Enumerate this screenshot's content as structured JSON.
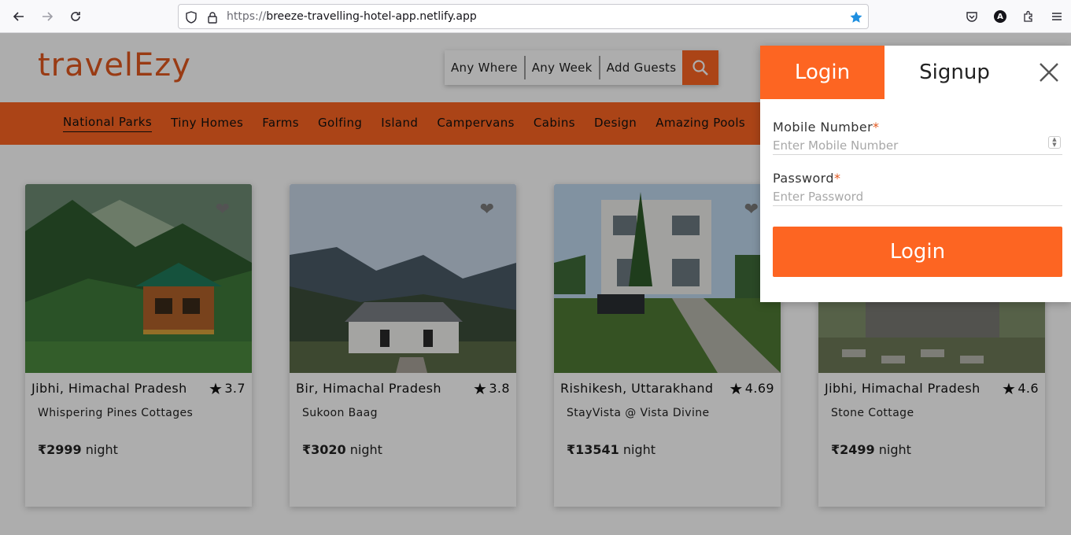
{
  "browser": {
    "url_protocol": "https://",
    "url_host": "breeze-travelling-hotel-app.netlify.app",
    "avatar_letter": "A"
  },
  "header": {
    "logo": "travelEzy",
    "search": {
      "where": "Any Where",
      "week": "Any Week",
      "guests": "Add Guests"
    }
  },
  "categories": [
    "National Parks",
    "Tiny Homes",
    "Farms",
    "Golfing",
    "Island",
    "Campervans",
    "Cabins",
    "Design",
    "Amazing Pools"
  ],
  "cards": [
    {
      "location": "Jibhi, Himachal Pradesh",
      "rating": "3.7",
      "name": "Whispering Pines Cottages",
      "price": "₹2999",
      "unit": "night"
    },
    {
      "location": "Bir, Himachal Pradesh",
      "rating": "3.8",
      "name": "Sukoon Baag",
      "price": "₹3020",
      "unit": "night"
    },
    {
      "location": "Rishikesh, Uttarakhand",
      "rating": "4.69",
      "name": "StayVista @ Vista Divine",
      "price": "₹13541",
      "unit": "night"
    },
    {
      "location": "Jibhi, Himachal Pradesh",
      "rating": "4.6",
      "name": "Stone Cottage",
      "price": "₹2499",
      "unit": "night"
    }
  ],
  "auth": {
    "tab_login": "Login",
    "tab_signup": "Signup",
    "mobile_label": "Mobile Number",
    "mobile_placeholder": "Enter Mobile Number",
    "password_label": "Password",
    "password_placeholder": "Enter Password",
    "required_mark": "*",
    "submit": "Login"
  },
  "colors": {
    "brand": "#fd6522",
    "logo": "#e2571e"
  }
}
